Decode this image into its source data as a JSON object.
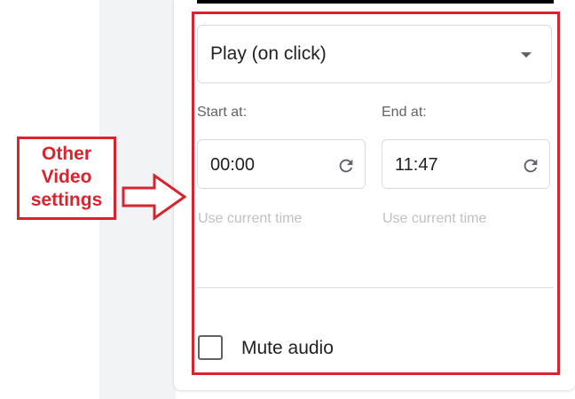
{
  "playback": {
    "mode_value": "Play (on click)"
  },
  "start": {
    "label": "Start at:",
    "value": "00:00",
    "hint": "Use current time"
  },
  "end": {
    "label": "End at:",
    "value": "11:47",
    "hint": "Use current time"
  },
  "mute": {
    "label": "Mute audio",
    "checked": false
  },
  "annotation": {
    "lines": [
      "Other",
      "Video",
      "settings"
    ],
    "color": "#d9232e"
  },
  "icons": {
    "dropdown": "caret-down-icon",
    "reset": "refresh-icon",
    "annotation": "arrow-right-icon"
  }
}
